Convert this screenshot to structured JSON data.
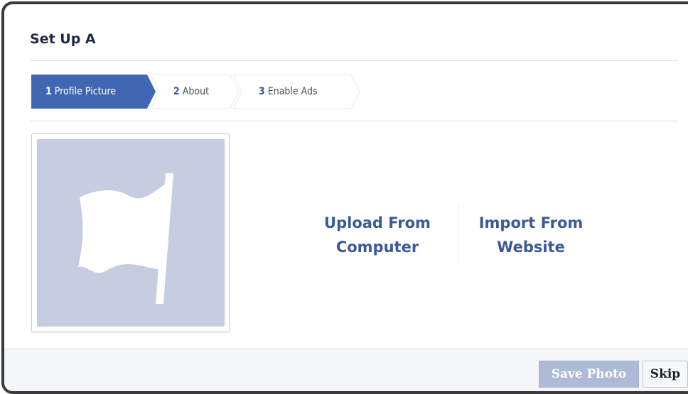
{
  "dialog": {
    "title": "Set Up A"
  },
  "steps": [
    {
      "number": "1",
      "label": "Profile Picture",
      "active": true
    },
    {
      "number": "2",
      "label": "About",
      "active": false
    },
    {
      "number": "3",
      "label": "Enable Ads",
      "active": false
    }
  ],
  "picture": {
    "icon": "flag-icon",
    "background_color": "#c6cde1"
  },
  "actions": {
    "upload_line1": "Upload From",
    "upload_line2": "Computer",
    "import_line1": "Import From",
    "import_line2": "Website"
  },
  "footer": {
    "save_label": "Save Photo",
    "skip_label": "Skip"
  },
  "colors": {
    "accent": "#3b5998",
    "active_step": "#4267b2",
    "save_disabled": "#adbad8"
  }
}
